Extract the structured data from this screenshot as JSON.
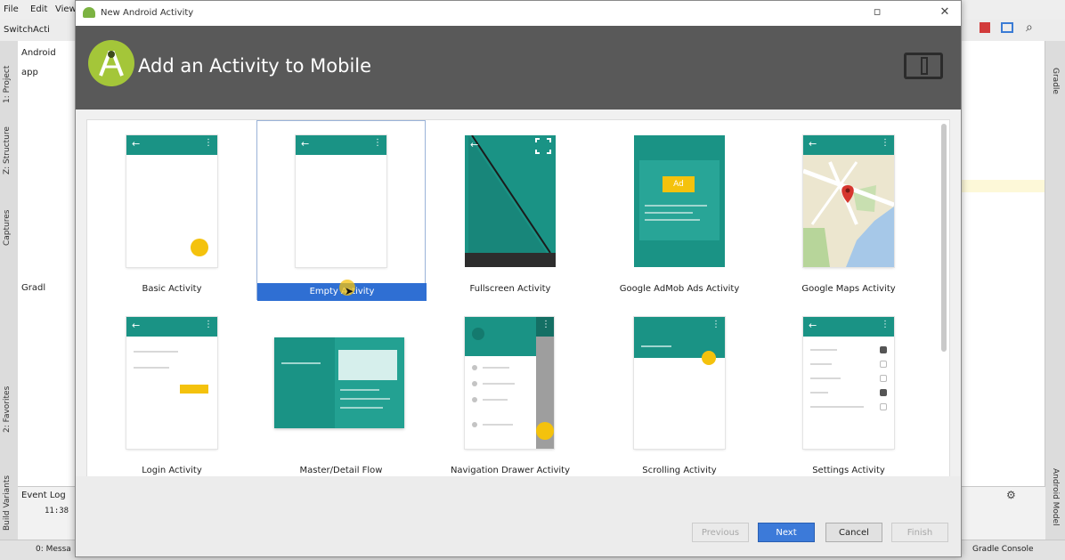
{
  "ide": {
    "menu": [
      "File",
      "Edit",
      "View"
    ],
    "tab_label": "SwitchActi",
    "tree_root": "Android",
    "tree_app": "app",
    "tree_gradle": "Gradl",
    "left_tabs": [
      "1: Project",
      "Z: Structure",
      "Captures",
      "2: Favorites",
      "Build Variants"
    ],
    "right_tabs": [
      "Gradle",
      "Android Model"
    ],
    "event_log": "Event Log",
    "event_time": "11:38",
    "status_messages": "0: Messa",
    "status_gradle": "Gradle Console"
  },
  "dialog": {
    "window_title": "New Android Activity",
    "header_title": "Add an Activity to Mobile",
    "templates": [
      {
        "name": "Basic Activity"
      },
      {
        "name": "Empty Activity",
        "selected": true
      },
      {
        "name": "Fullscreen Activity"
      },
      {
        "name": "Google AdMob Ads Activity",
        "ad_badge": "Ad"
      },
      {
        "name": "Google Maps Activity"
      },
      {
        "name": "Login Activity"
      },
      {
        "name": "Master/Detail Flow"
      },
      {
        "name": "Navigation Drawer Activity"
      },
      {
        "name": "Scrolling Activity"
      },
      {
        "name": "Settings Activity"
      }
    ],
    "buttons": {
      "previous": "Previous",
      "next": "Next",
      "cancel": "Cancel",
      "finish": "Finish"
    }
  },
  "colors": {
    "teal": "#1a9385",
    "accent_yellow": "#f4c20d",
    "selection_blue": "#2f6fd3",
    "header_grey": "#595959",
    "android_green": "#a4c639"
  }
}
